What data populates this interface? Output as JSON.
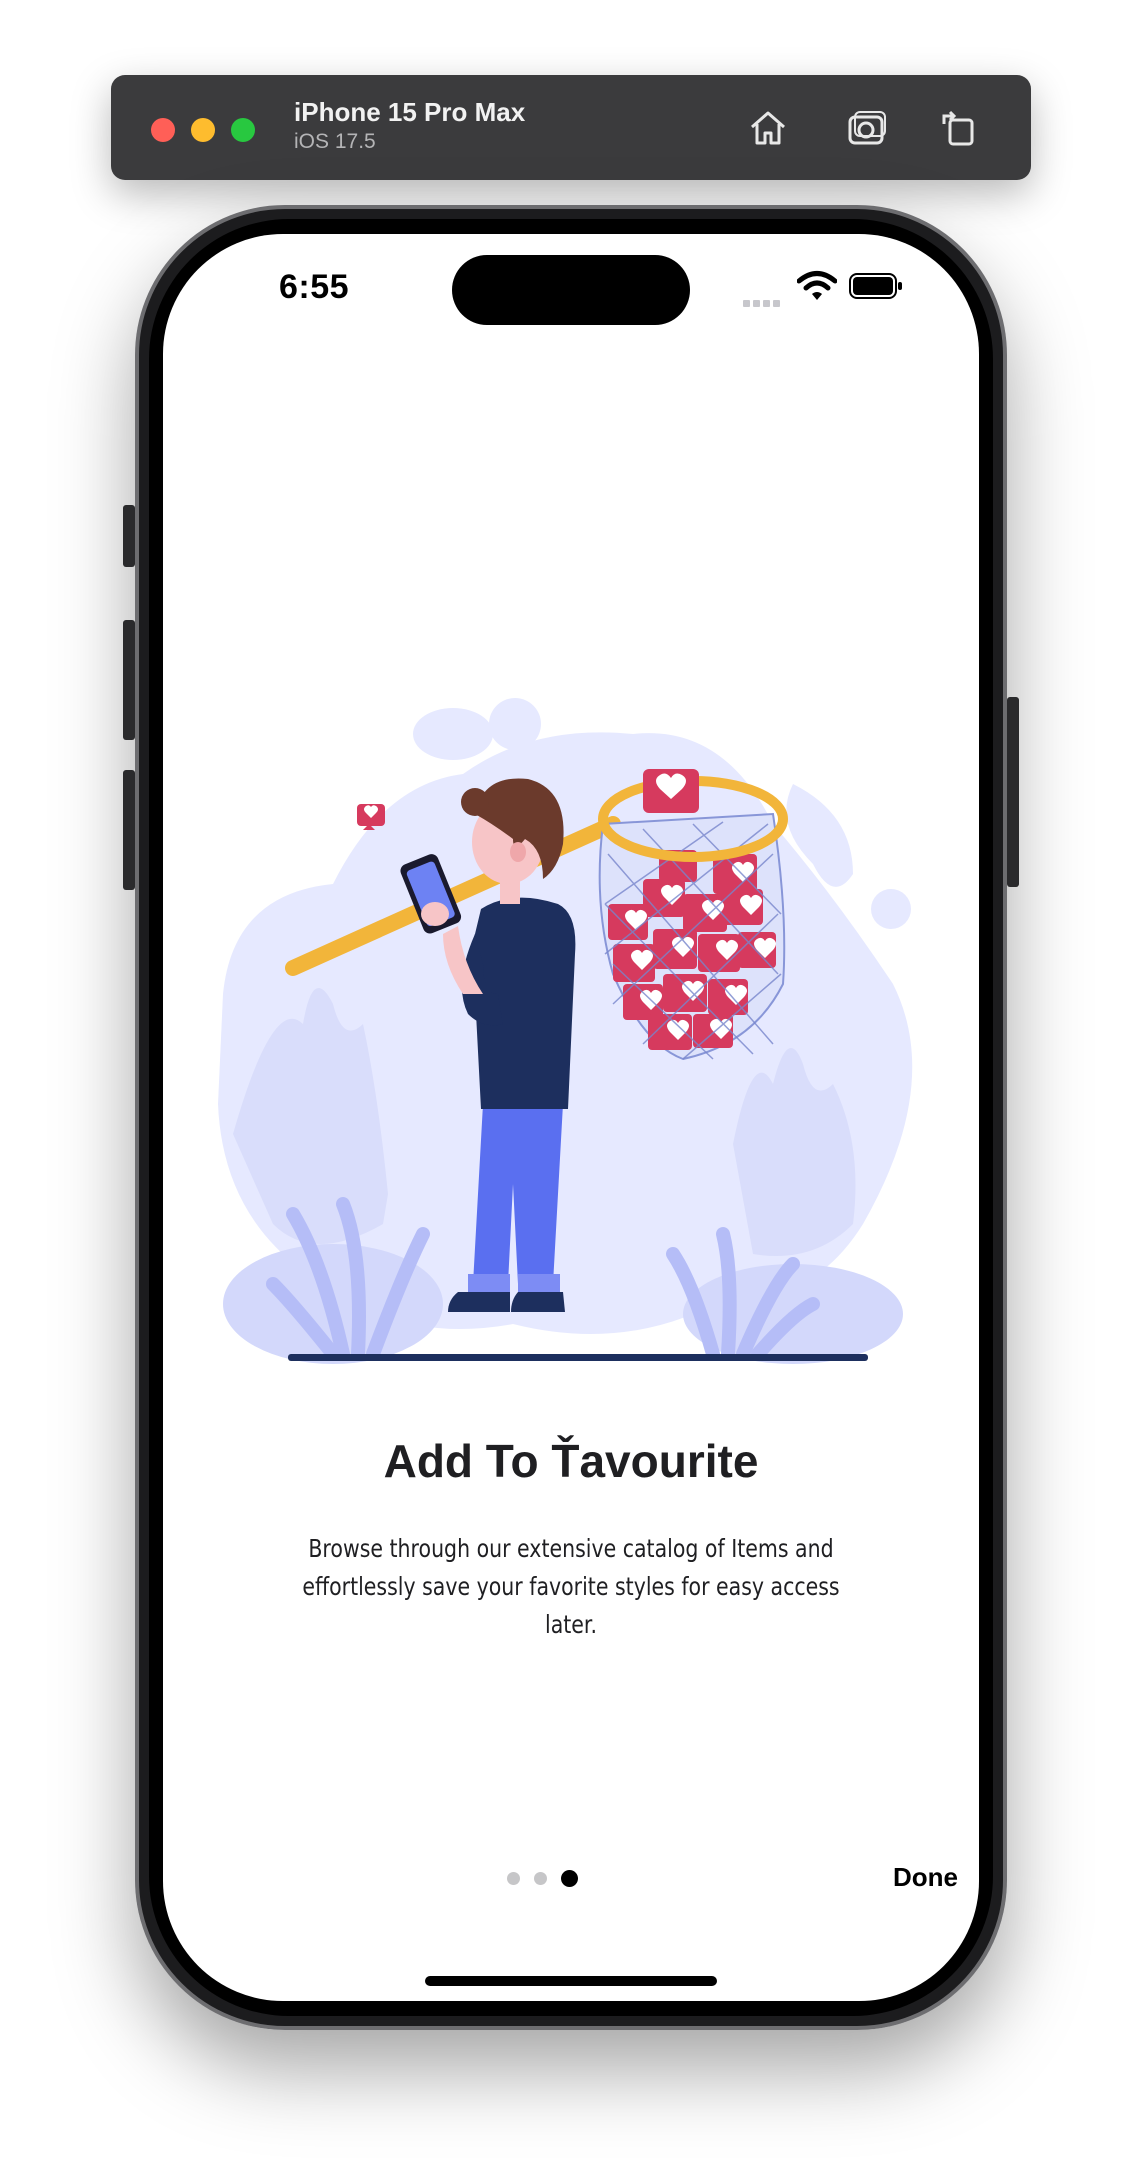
{
  "simulator": {
    "device_name": "iPhone 15 Pro Max",
    "os_version": "iOS 17.5",
    "icons": [
      "home-icon",
      "screenshot-icon",
      "rotate-icon"
    ]
  },
  "status_bar": {
    "time": "6:55"
  },
  "onboarding": {
    "title": "Add To Ťavourite",
    "description": "Browse through our extensive catalog of Items and effortlessly save your favorite styles for easy access later.",
    "page_count": 3,
    "current_page": 3,
    "done_label": "Done"
  },
  "colors": {
    "accent_indicator": "#000000",
    "inactive_indicator": "#c6c6c8",
    "illustration_blob": "#e6e9ff",
    "heart_red": "#d63a5e",
    "net_handle": "#f2b53a",
    "shirt": "#1d2f5e",
    "jeans": "#5a6ff0"
  }
}
